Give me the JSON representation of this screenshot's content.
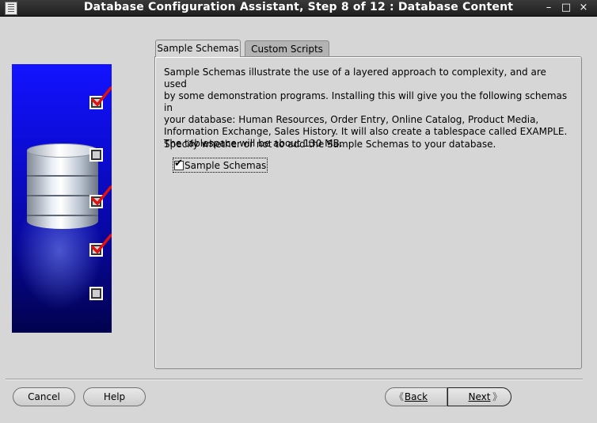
{
  "window": {
    "title": "Database Configuration Assistant, Step 8 of 12 : Database Content",
    "controls": {
      "minimize": "–",
      "maximize": "□",
      "close": "×"
    }
  },
  "side_panel": {
    "steps": [
      {
        "checked": true
      },
      {
        "checked": false
      },
      {
        "checked": true
      },
      {
        "checked": true
      },
      {
        "checked": false
      }
    ],
    "colors": {
      "panel": "#0d0ddf",
      "tick": "#e01010"
    }
  },
  "tabs": [
    {
      "label": "Sample Schemas",
      "active": true
    },
    {
      "label": "Custom Scripts",
      "active": false
    }
  ],
  "content": {
    "description": "Sample Schemas illustrate the use of a layered approach to complexity, and are used\nby some demonstration programs. Installing this will give you the following schemas in\nyour database: Human Resources, Order Entry, Online Catalog, Product Media,\nInformation Exchange, Sales History. It will also create a tablespace called EXAMPLE.\nThe tablespace will be about 130 MB.",
    "specify": "Specify whether or not to add the Sample Schemas to your database.",
    "sample_schemas_checkbox": {
      "label": "Sample Schemas",
      "checked": true,
      "mark": "✔"
    }
  },
  "buttons": {
    "cancel": "Cancel",
    "help": "Help",
    "back": "Back",
    "next": "Next",
    "back_chevron": "《",
    "next_chevron": "》"
  }
}
